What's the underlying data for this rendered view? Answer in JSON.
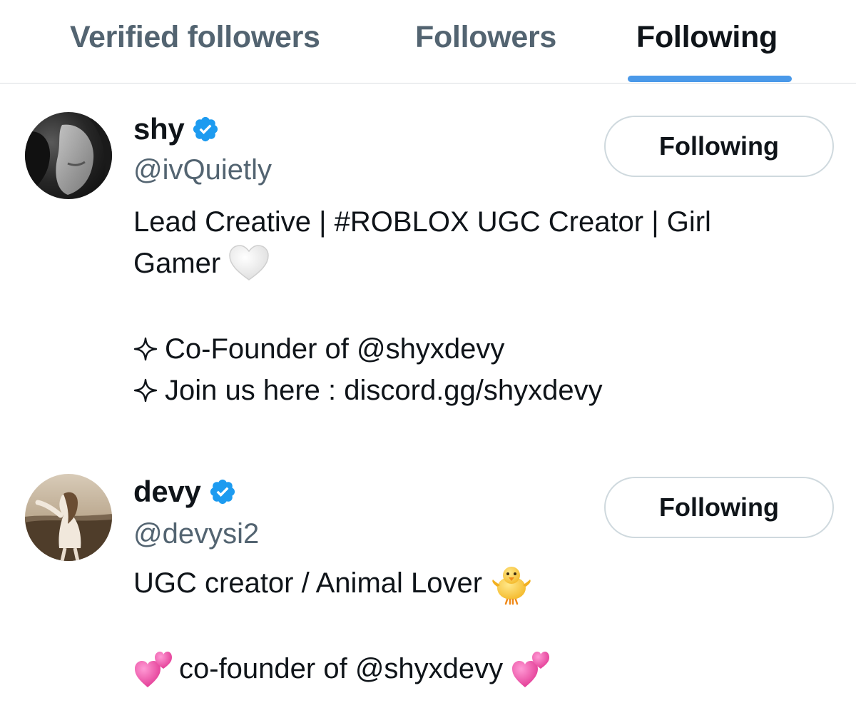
{
  "tabs": [
    {
      "label": "Verified followers",
      "active": false
    },
    {
      "label": "Followers",
      "active": false
    },
    {
      "label": "Following",
      "active": true
    }
  ],
  "users": [
    {
      "name": "shy",
      "handle": "@ivQuietly",
      "verified": true,
      "button_label": "Following",
      "bio": {
        "line1": "Lead Creative | #ROBLOX UGC Creator | Girl",
        "line2": "Gamer",
        "line2_emoji": "white-heart-icon",
        "line3": "Co-Founder of @shyxdevy",
        "line4": "Join us here : discord.gg/shyxdevy",
        "bullet_icon": "four-point-sparkle-icon"
      }
    },
    {
      "name": "devy",
      "handle": "@devysi2",
      "verified": true,
      "button_label": "Following",
      "bio": {
        "line1": "UGC creator / Animal Lover",
        "line1_emoji": "baby-chick-icon",
        "line2": "co-founder of @shyxdevy",
        "line2_emoji": "two-hearts-icon"
      }
    }
  ],
  "colors": {
    "accent": "#4a99e9",
    "verified": "#1d9bf0",
    "text_primary": "#0f1419",
    "text_secondary": "#536471",
    "border": "#cfd9de"
  }
}
